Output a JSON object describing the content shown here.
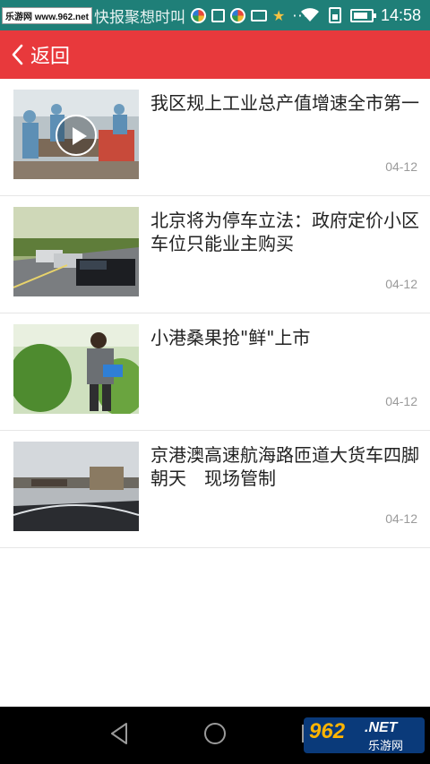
{
  "status_bar": {
    "watermark": "乐游网 www.962.net",
    "notification_text": "快报聚想时叫",
    "time": "14:58",
    "battery_level": 0.85
  },
  "app_bar": {
    "back_label": "返回"
  },
  "news": [
    {
      "title": "我区规上工业总产值增速全市第一",
      "date": "04-12",
      "thumbnail": "factory-workers",
      "has_video": true
    },
    {
      "title": "北京将为停车立法：政府定价小区车位只能业主购买",
      "date": "04-12",
      "thumbnail": "parked-cars",
      "has_video": false
    },
    {
      "title": "小港桑果抢\"鲜\"上市",
      "date": "04-12",
      "thumbnail": "mulberry-picker",
      "has_video": false
    },
    {
      "title": "京港澳高速航海路匝道大货车四脚朝天　现场管制",
      "date": "04-12",
      "thumbnail": "overturned-truck",
      "has_video": false
    }
  ],
  "nav_bar": {
    "logo_number": "962",
    "logo_domain": ".NET",
    "logo_text": "乐游网"
  },
  "colors": {
    "status_bar": "#1f7f78",
    "app_bar": "#e8393c",
    "date_text": "#9a9a9a"
  }
}
